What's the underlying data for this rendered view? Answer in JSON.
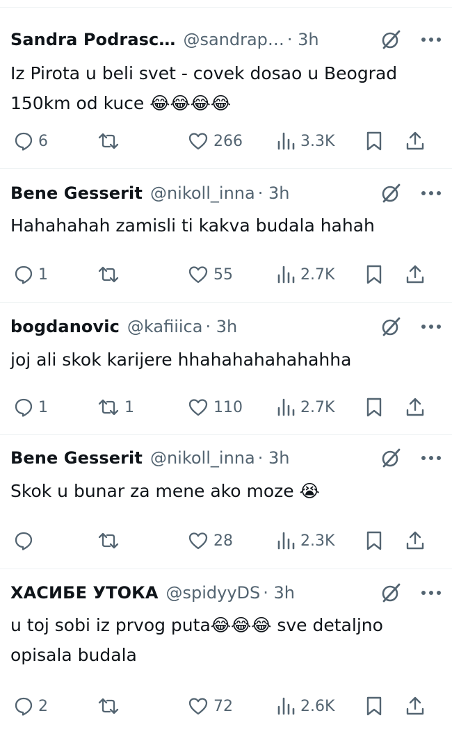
{
  "colors": {
    "text": "#0f1419",
    "secondary": "#536471",
    "divider": "#eff3f4"
  },
  "icons": {
    "reply": "speech-bubble-icon",
    "retweet": "retweet-arrows-icon",
    "like": "heart-icon",
    "views": "bar-chart-icon",
    "bookmark": "bookmark-icon",
    "share": "share-upload-icon",
    "grok": "grok-slash-icon",
    "more": "ellipsis-icon"
  },
  "tweets": [
    {
      "name": "Sandra Podrasc…",
      "handle": "@sandrap…",
      "time": "· 3h",
      "text": "Iz Pirota u beli svet - covek dosao u Beograd 150km od kuce 😂😂😂😂",
      "replies": "6",
      "retweets": "",
      "likes": "266",
      "views": "3.3K"
    },
    {
      "name": "Bene Gesserit",
      "handle": "@nikoll_inna",
      "time": "· 3h",
      "text": "Hahahahah zamisli ti kakva budala hahah",
      "replies": "1",
      "retweets": "",
      "likes": "55",
      "views": "2.7K"
    },
    {
      "name": "bogdanovic",
      "handle": "@kafiiica",
      "time": "· 3h",
      "text": "joj ali skok karijere hhahahahahahahha",
      "replies": "1",
      "retweets": "1",
      "likes": "110",
      "views": "2.7K"
    },
    {
      "name": "Bene Gesserit",
      "handle": "@nikoll_inna",
      "time": "· 3h",
      "text": "Skok u bunar za mene ako moze 😭",
      "replies": "",
      "retweets": "",
      "likes": "28",
      "views": "2.3K"
    },
    {
      "name": "ХАСИБЕ УТОКА",
      "handle": "@spidyyDS",
      "time": "· 3h",
      "text": "u toj sobi iz prvog puta😂😂😂 sve detaljno opisala budala",
      "replies": "2",
      "retweets": "",
      "likes": "72",
      "views": "2.6K"
    }
  ]
}
